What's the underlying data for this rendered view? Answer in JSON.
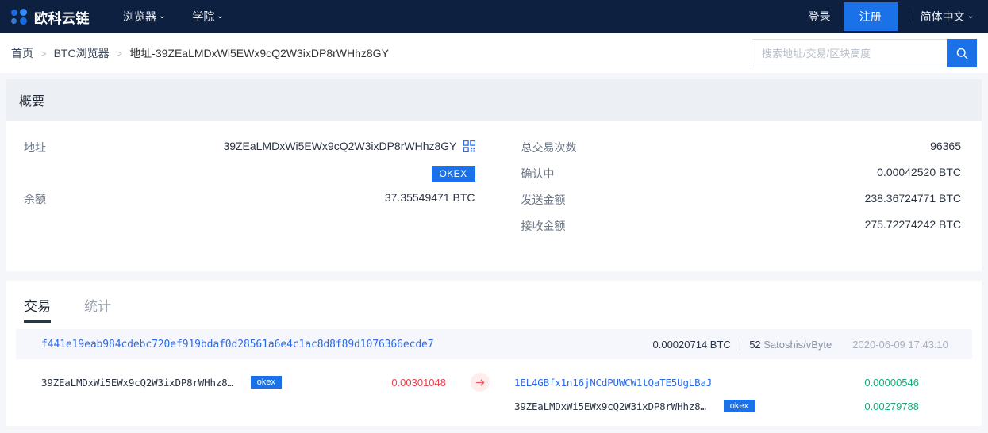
{
  "topnav": {
    "brand": "欧科云链",
    "menu": [
      {
        "label": "浏览器",
        "icon": "chevron-down-icon"
      },
      {
        "label": "学院",
        "icon": "chevron-down-icon"
      }
    ],
    "login_label": "登录",
    "register_label": "注册",
    "language_label": "简体中文",
    "bg_color": "#0d2040",
    "accent_color": "#1b72e8"
  },
  "breadcrumb": {
    "home": "首页",
    "sep": ">",
    "explorer": "BTC浏览器",
    "current": "地址-39ZEaLMDxWi5EWx9cQ2W3ixDP8rWHhz8GY"
  },
  "search": {
    "placeholder": "搜索地址/交易/区块高度",
    "value": "",
    "icon": "search-icon"
  },
  "overview": {
    "title": "概要",
    "left": {
      "address_label": "地址",
      "address_value": "39ZEaLMDxWi5EWx9cQ2W3ixDP8rWHhz8GY",
      "qr_icon": "qr-code-icon",
      "tag": "OKEX",
      "balance_label": "余额",
      "balance_value": "37.35549471 BTC"
    },
    "right": [
      {
        "label": "总交易次数",
        "value": "96365"
      },
      {
        "label": "确认中",
        "value": "0.00042520 BTC"
      },
      {
        "label": "发送金额",
        "value": "238.36724771 BTC"
      },
      {
        "label": "接收金额",
        "value": "275.72274242 BTC"
      }
    ]
  },
  "tabs": [
    {
      "label": "交易",
      "active": true
    },
    {
      "label": "统计",
      "active": false
    }
  ],
  "transaction": {
    "hash": "f441e19eab984cdebc720ef919bdaf0d28561a6e4c1ac8d8f89d1076366ecde7",
    "fee": "0.00020714 BTC",
    "separator": "|",
    "fee_rate_value": "52",
    "fee_rate_unit": "Satoshis/vByte",
    "time": "2020-06-09 17:43:10",
    "arrow_icon": "arrow-right-icon",
    "inputs": [
      {
        "address": "39ZEaLMDxWi5EWx9cQ2W3ixDP8rWHhz8…",
        "tag": "okex",
        "amount": "0.00301048",
        "is_link": false
      }
    ],
    "outputs": [
      {
        "address": "1EL4GBfx1n16jNCdPUWCW1tQaTE5UgLBaJ",
        "tag": "",
        "amount": "0.00000546",
        "is_link": true
      },
      {
        "address": "39ZEaLMDxWi5EWx9cQ2W3ixDP8rWHhz8…",
        "tag": "okex",
        "amount": "0.00279788",
        "is_link": false
      }
    ]
  }
}
